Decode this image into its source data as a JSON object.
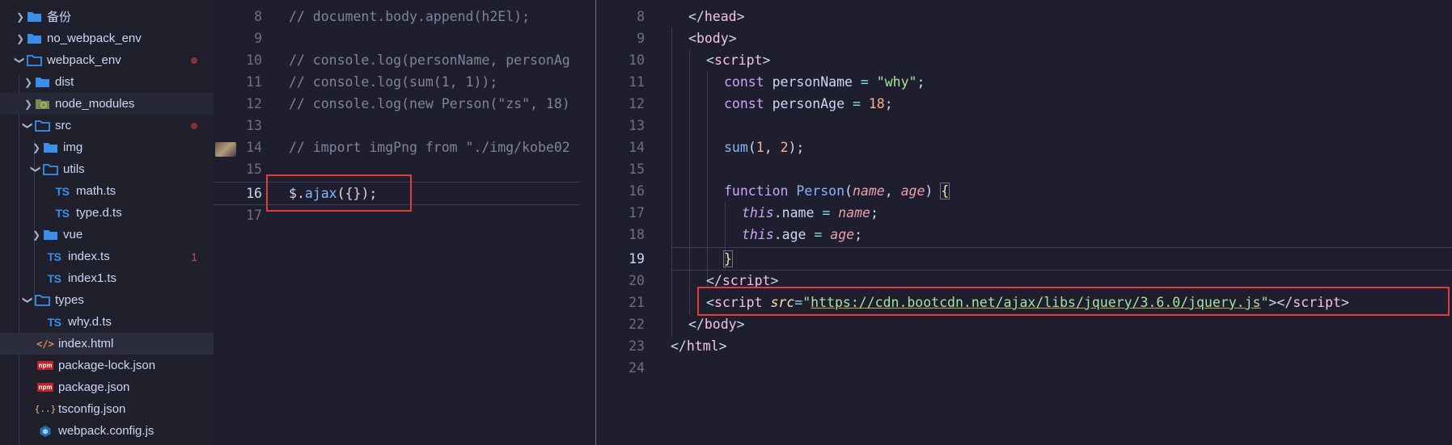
{
  "explorer": {
    "items": [
      {
        "label": "备份",
        "icon": "folder-icon"
      },
      {
        "label": "no_webpack_env",
        "icon": "folder-icon"
      },
      {
        "label": "webpack_env",
        "icon": "folder-open-icon"
      },
      {
        "label": "dist",
        "icon": "folder-icon"
      },
      {
        "label": "node_modules",
        "icon": "node-folder-icon"
      },
      {
        "label": "src",
        "icon": "folder-open-icon"
      },
      {
        "label": "img",
        "icon": "folder-icon"
      },
      {
        "label": "utils",
        "icon": "folder-open-icon"
      },
      {
        "label": "math.ts",
        "icon": "ts-file-icon",
        "icon_text": "TS"
      },
      {
        "label": "type.d.ts",
        "icon": "ts-file-icon",
        "icon_text": "TS"
      },
      {
        "label": "vue",
        "icon": "folder-icon"
      },
      {
        "label": "index.ts",
        "icon": "ts-file-icon",
        "icon_text": "TS",
        "badge": "1"
      },
      {
        "label": "index1.ts",
        "icon": "ts-file-icon",
        "icon_text": "TS"
      },
      {
        "label": "types",
        "icon": "folder-open-icon"
      },
      {
        "label": "why.d.ts",
        "icon": "ts-file-icon",
        "icon_text": "TS"
      },
      {
        "label": "index.html",
        "icon": "html-file-icon",
        "icon_text": "</>"
      },
      {
        "label": "package-lock.json",
        "icon": "npm-file-icon",
        "icon_text": "npm"
      },
      {
        "label": "package.json",
        "icon": "npm-file-icon",
        "icon_text": "npm"
      },
      {
        "label": "tsconfig.json",
        "icon": "json-file-icon",
        "icon_text": "{..}"
      },
      {
        "label": "webpack.config.js",
        "icon": "webpack-file-icon"
      }
    ]
  },
  "left_editor": {
    "line_numbers": [
      "8",
      "9",
      "10",
      "11",
      "12",
      "13",
      "14",
      "15",
      "16",
      "17"
    ],
    "lines": [
      "// document.body.append(h2El);",
      "",
      "// console.log(personName, personAg",
      "// console.log(sum(1, 1));",
      "// console.log(new Person(\"zs\", 18)",
      "",
      "// import imgPng from \"./img/kobe02",
      "",
      "$.ajax({});",
      ""
    ],
    "active_line": "16"
  },
  "right_editor": {
    "line_numbers": [
      "8",
      "9",
      "10",
      "11",
      "12",
      "13",
      "14",
      "15",
      "16",
      "17",
      "18",
      "19",
      "20",
      "21",
      "22",
      "23",
      "24"
    ],
    "tokens": {
      "l8": [
        "</",
        "head",
        ">"
      ],
      "l9": [
        "<",
        "body",
        ">"
      ],
      "l10": [
        "<",
        "script",
        ">"
      ],
      "l11": [
        "const",
        " personName ",
        "=",
        " ",
        "\"why\"",
        ";"
      ],
      "l12": [
        "const",
        " personAge ",
        "=",
        " ",
        "18",
        ";"
      ],
      "l14": [
        "sum",
        "(",
        "1",
        ", ",
        "2",
        ");"
      ],
      "l16": [
        "function",
        " ",
        "Person",
        "(",
        "name",
        ", ",
        "age",
        ") ",
        "{"
      ],
      "l17": [
        "this",
        ".name ",
        "=",
        " ",
        "name",
        ";"
      ],
      "l18": [
        "this",
        ".age ",
        "=",
        " ",
        "age",
        ";"
      ],
      "l19": [
        "}"
      ],
      "l20": [
        "</",
        "script",
        ">"
      ],
      "l21": [
        "<",
        "script",
        " ",
        "src",
        "=",
        "\"",
        "https://cdn.bootcdn.net/ajax/libs/jquery/3.6.0/jquery.js",
        "\"",
        "></",
        "script",
        ">"
      ],
      "l22": [
        "</",
        "body",
        ">"
      ],
      "l23": [
        "</",
        "html",
        ">"
      ]
    },
    "active_line": "19"
  },
  "colors": {
    "highlight_box": "#e03c3c",
    "background": "#1e1e2e",
    "sidebar": "#1f202c"
  }
}
